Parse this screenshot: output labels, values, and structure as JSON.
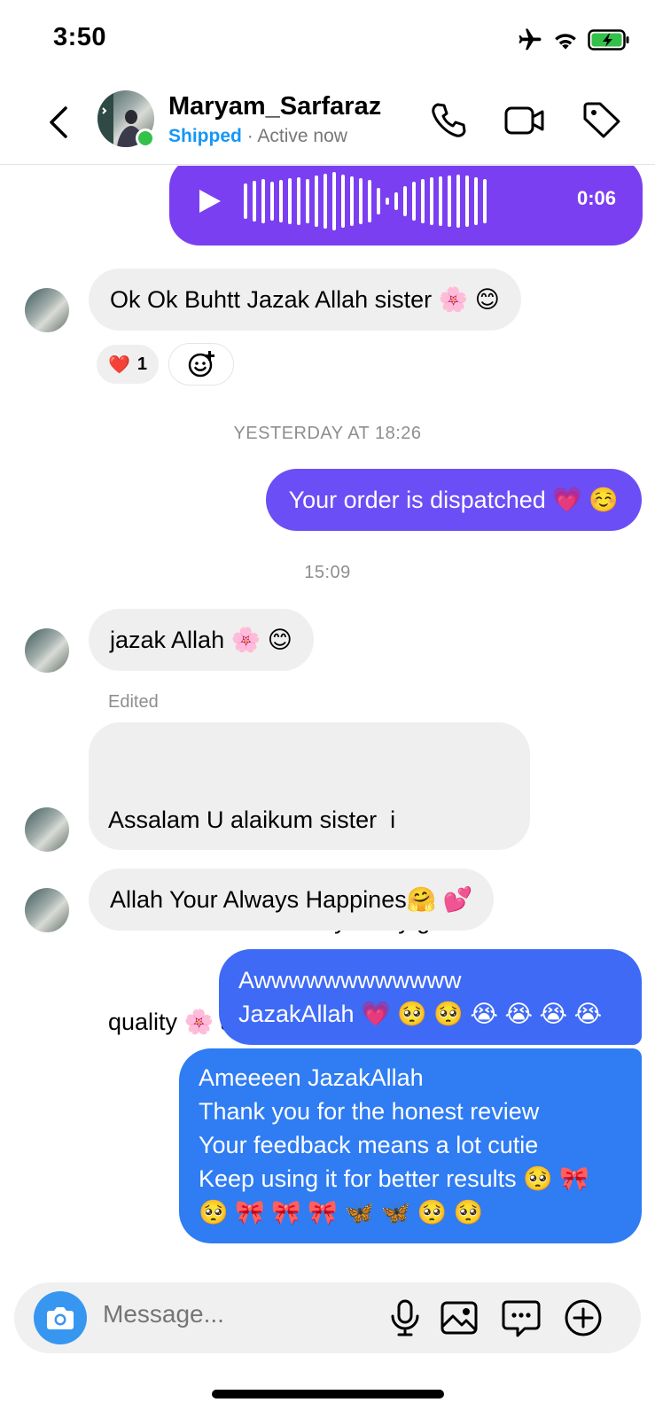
{
  "status_bar": {
    "time": "3:50",
    "icons": [
      "airplane-icon",
      "wifi-icon",
      "battery-charging-icon"
    ]
  },
  "header": {
    "name": "Maryam_Sarfaraz",
    "label": "Shipped",
    "separator": "·",
    "presence": "Active now",
    "colors": {
      "label": "#1697f6",
      "online": "#33c14a"
    }
  },
  "thread": {
    "voice": {
      "duration": "0:06"
    },
    "msg1": {
      "text": "Ok Ok Buhtt Jazak Allah sister 🌸 😊",
      "reaction_emoji": "❤️",
      "reaction_count": "1"
    },
    "stamp1": "YESTERDAY AT 18:26",
    "msg2": {
      "text": "Your order is dispatched 💗 ☺️"
    },
    "stamp2": "15:09",
    "msg3": {
      "text": "jazak Allah 🌸 😊"
    },
    "edited": "Edited",
    "msg4": {
      "line1": "Assalam U alaikum sister  i",
      "line2": " used face wash 6 day really good",
      "line3": "quality 🌸 amazing 😍  results mile"
    },
    "msg5": {
      "text": "Allah Your Always Happines🤗 💕"
    },
    "msg6": {
      "line1": "Awwwwwwwwwwww",
      "line2": "JazakAllah 💗 🥺 🥺 😭 😭 😭 😭"
    },
    "msg7": {
      "line1": "Ameeeen JazakAllah",
      "line2": "Thank you for the honest review",
      "line3": "Your feedback means a lot cutie",
      "line4": "Keep using it for better results 🥺 🎀",
      "line5": "🥺 🎀 🎀 🎀 🦋 🦋 🥺 🥺"
    },
    "colors": {
      "voice": "#7b3ff2",
      "out_purple": "#6b4ef6",
      "out_blue_top": "#3f6af6",
      "out_blue_bottom": "#2f7cf3",
      "in_bubble": "#efefef"
    }
  },
  "composer": {
    "placeholder": "Message..."
  }
}
